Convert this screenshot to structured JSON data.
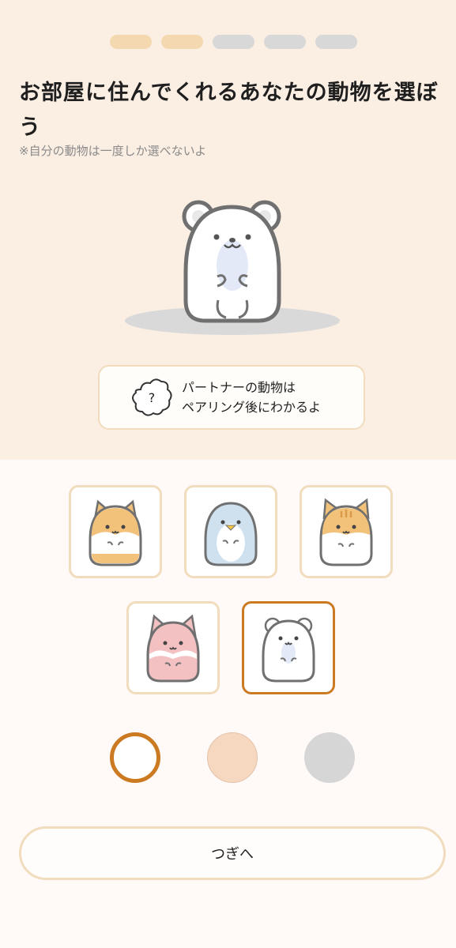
{
  "progress": {
    "total_steps": 5,
    "completed_steps": 2
  },
  "header": {
    "title": "お部屋に住んでくれるあなたの動物を選ぼう",
    "note": "※自分の動物は一度しか選べないよ"
  },
  "preview": {
    "animal": "polar-bear"
  },
  "partner_notice": {
    "icon": "question-cloud-icon",
    "line1": "パートナーの動物は",
    "line2": "ペアリング後にわかるよ"
  },
  "animals": [
    {
      "id": "shiba-dog",
      "selected": false
    },
    {
      "id": "penguin",
      "selected": false
    },
    {
      "id": "tabby-cat",
      "selected": false
    },
    {
      "id": "pink-fox",
      "selected": false
    },
    {
      "id": "polar-bear",
      "selected": true
    }
  ],
  "colors": [
    {
      "id": "white",
      "hex": "#ffffff",
      "selected": true
    },
    {
      "id": "peach",
      "hex": "#f6d7bf",
      "selected": false
    },
    {
      "id": "gray",
      "hex": "#d6d6d6",
      "selected": false
    }
  ],
  "accent": "#cc7a22",
  "next_label": "つぎへ"
}
